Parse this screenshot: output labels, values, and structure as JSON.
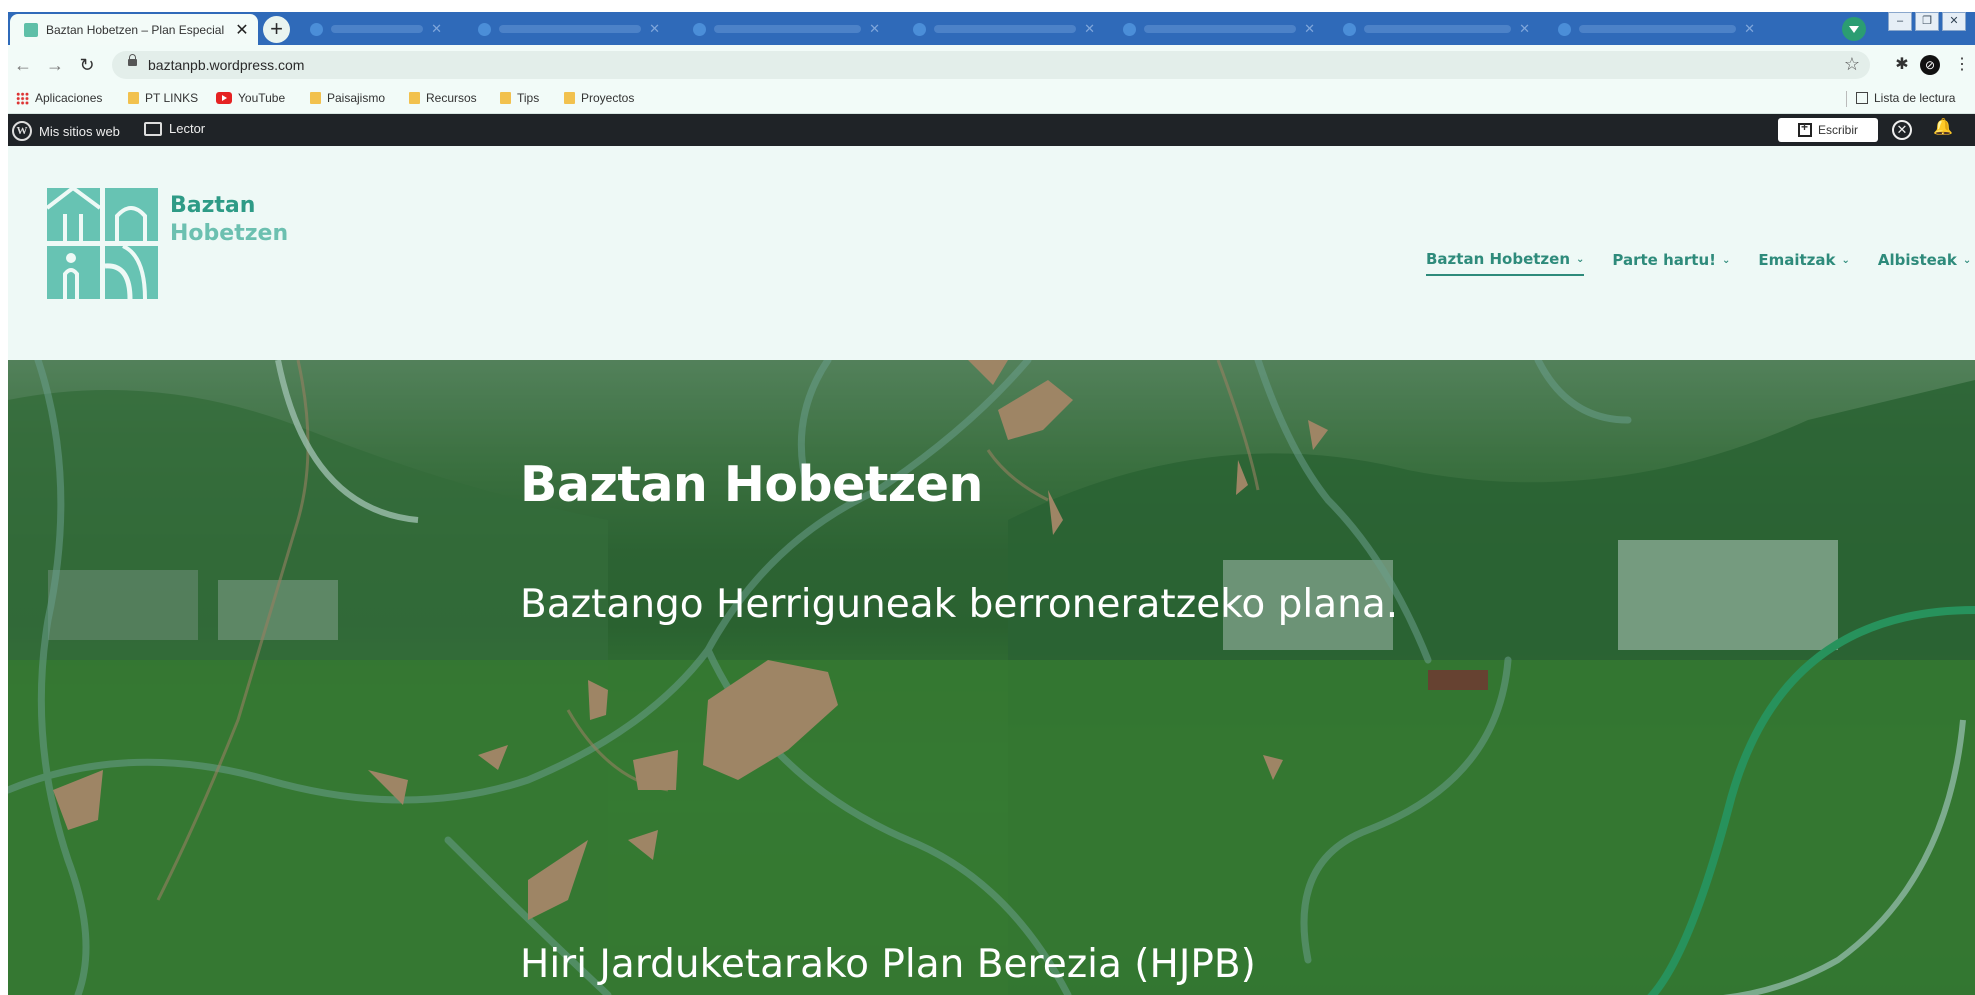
{
  "browser": {
    "active_tab": {
      "title": "Baztan Hobetzen – Plan Especial",
      "close": "✕"
    },
    "new_tab": "+",
    "url": "baztanpb.wordpress.com",
    "window_controls": [
      "–",
      "❐",
      "✕"
    ]
  },
  "bookmarks": {
    "items": [
      {
        "label": "Aplicaciones",
        "icon": "apps-grid-icon"
      },
      {
        "label": "PT LINKS",
        "icon": "folder-icon"
      },
      {
        "label": "YouTube",
        "icon": "youtube-icon"
      },
      {
        "label": "Paisajismo",
        "icon": "folder-icon"
      },
      {
        "label": "Recursos",
        "icon": "folder-icon"
      },
      {
        "label": "Tips",
        "icon": "folder-icon"
      },
      {
        "label": "Proyectos",
        "icon": "folder-icon"
      }
    ],
    "reading_list": "Lista de lectura"
  },
  "adminbar": {
    "my_sites": "Mis sitios web",
    "reader": "Lector",
    "write": "Escribir"
  },
  "site": {
    "logo_line1": "Baztan",
    "logo_line2": "Hobetzen",
    "nav": [
      {
        "label": "Baztan Hobetzen",
        "active": true
      },
      {
        "label": "Parte hartu!",
        "active": false
      },
      {
        "label": "Emaitzak",
        "active": false
      },
      {
        "label": "Albisteak",
        "active": false
      }
    ]
  },
  "hero": {
    "title": "Baztan Hobetzen",
    "subtitle": "Baztango Herriguneak berroneratzeko plana.",
    "subtitle2": "Hiri Jarduketarako Plan Berezia (HJPB)"
  },
  "colors": {
    "brand_green": "#2e9b86",
    "tab_strip": "#2f6ab9",
    "admin_bar": "#1f2327"
  }
}
